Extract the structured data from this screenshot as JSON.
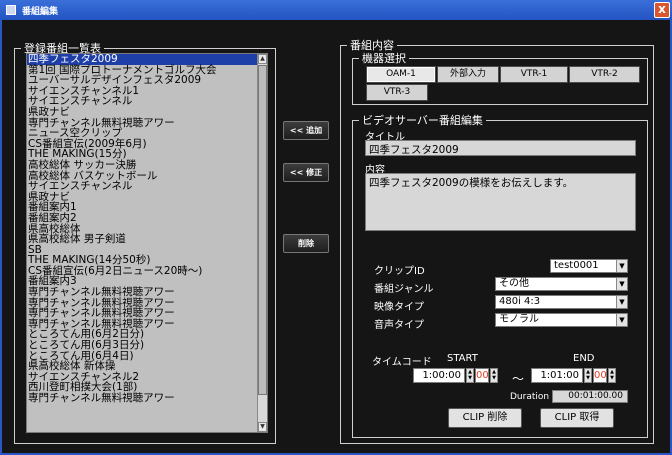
{
  "window": {
    "title": "番組編集",
    "close_label": "x"
  },
  "program_list": {
    "legend": "登録番組一覧表",
    "selected_index": 0,
    "items": [
      "四季フェスタ2009",
      "第1回 国際プロトーナメントゴルフ大会",
      "ユーバーサルデザインフェスタ2009",
      "サイエンスチャンネル1",
      "サイエンスチャンネル",
      "県政ナビ",
      "専門チャンネル無料視聴アワー",
      "ニュース空クリップ",
      "CS番組宣伝(2009年6月)",
      "THE MAKING(15分)",
      "高校総体 サッカー決勝",
      "高校総体 バスケットボール",
      "サイエンスチャンネル",
      "県政ナビ",
      "番組案内1",
      "番組案内2",
      "県高校総体",
      "県高校総体 男子剣道",
      "SB",
      "THE MAKING(14分50秒)",
      "CS番組宣伝(6月2日ニュース20時～)",
      "番組案内3",
      "専門チャンネル無料視聴アワー",
      "専門チャンネル無料視聴アワー",
      "専門チャンネル無料視聴アワー",
      "専門チャンネル無料視聴アワー",
      "ところてん用(6月2日分)",
      "ところてん用(6月3日分)",
      "ところてん用(6月4日)",
      "県高校総体 新体操",
      "サイエンスチャンネル2",
      "西川登町相撲大会(1部)",
      "専門チャンネル無料視聴アワー"
    ]
  },
  "actions": {
    "add": "<< 追加",
    "modify": "<< 修正",
    "delete": "削除"
  },
  "program_content": {
    "legend": "番組内容",
    "device_select": {
      "legend": "機器選択",
      "buttons": [
        "OAM-1",
        "外部入力",
        "VTR-1",
        "VTR-2",
        "VTR-3"
      ],
      "active": "OAM-1"
    },
    "video_server": {
      "legend": "ビデオサーバー番組編集",
      "title_label": "タイトル",
      "title_value": "四季フェスタ2009",
      "content_label": "内容",
      "content_value": "四季フェスタ2009の模様をお伝えします。",
      "clip_id_label": "クリップID",
      "clip_id_value": "test0001",
      "genre_label": "番組ジャンル",
      "genre_value": "その他",
      "video_type_label": "映像タイプ",
      "video_type_value": "480i 4:3",
      "audio_type_label": "音声タイプ",
      "audio_type_value": "モノラル",
      "timecode_label": "タイムコード",
      "start_label": "START",
      "end_label": "END",
      "start_time": "1:00:00",
      "start_frames": "00",
      "tilde": "～",
      "end_time": "1:01:00",
      "end_frames": "00",
      "duration_label": "Duration",
      "duration_value": "00:01:00.00",
      "clip_delete": "CLIP 削除",
      "clip_get": "CLIP 取得"
    }
  }
}
